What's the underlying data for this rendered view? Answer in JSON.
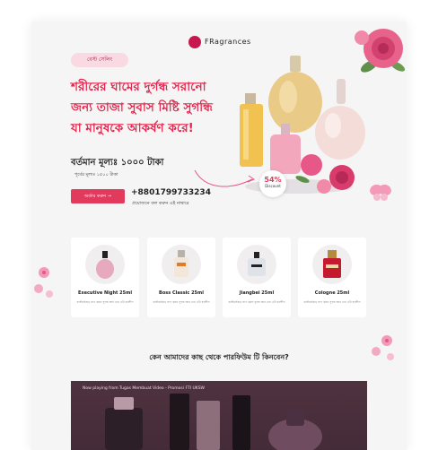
{
  "brand": {
    "name": "FRagrances"
  },
  "hero": {
    "badge": "বেস্ট সেলিং",
    "headline_lines": [
      "শরীরের ঘামের দুর্গন্ধ সরানো",
      "জন্য তাজা সুবাস মিষ্টি সুগন্ধি",
      "যা মানুষকে আকর্ষণ করে!"
    ],
    "price_text": "বর্তমান মূল্যঃ ১০০০ টাকা",
    "old_price_text": "পূর্বের মূল্যঃ ১৫০০ টাকা",
    "order_button": "অর্ডার করুন →",
    "phone": "+8801799733234",
    "phone_note": "প্রয়োজনে কল করুন এই নাম্বারে",
    "discount_percent": "54%",
    "discount_label": "Discount"
  },
  "products": [
    {
      "name": "Executive Night 25ml",
      "desc": "কাস্টমাইজড লাগ করুন সুগন্ধ আর এবং এটা যত্নশীল"
    },
    {
      "name": "Boss Classic 25ml",
      "desc": "কাস্টমাইজড লাগ করুন সুগন্ধ আর এবং এটা যত্নশীল"
    },
    {
      "name": "Jiangbei 25ml",
      "desc": "কাস্টমাইজড লাগ করুন সুগন্ধ আর এবং এটা যত্নশীল"
    },
    {
      "name": "Cologne 25ml",
      "desc": "কাস্টমাইজড লাগ করুন সুগন্ধ আর এবং এটা যত্নশীল"
    }
  ],
  "why_section": {
    "title": "কেন আমাদের কাছ থেকে পারফিউম টি কিনবেন?"
  },
  "video": {
    "now_playing": "Now playing from Tugas Membuat Video - Promosi FTI UKSW"
  },
  "colors": {
    "accent": "#e4284f",
    "badge_bg": "#f9d9e2",
    "button": "#e23a5c",
    "page_bg": "#f6f5f6"
  },
  "icons": [
    "brand-logo-icon",
    "arrow-right-icon",
    "rose-icon",
    "butterfly-icon",
    "perfume-bottle-icon"
  ]
}
